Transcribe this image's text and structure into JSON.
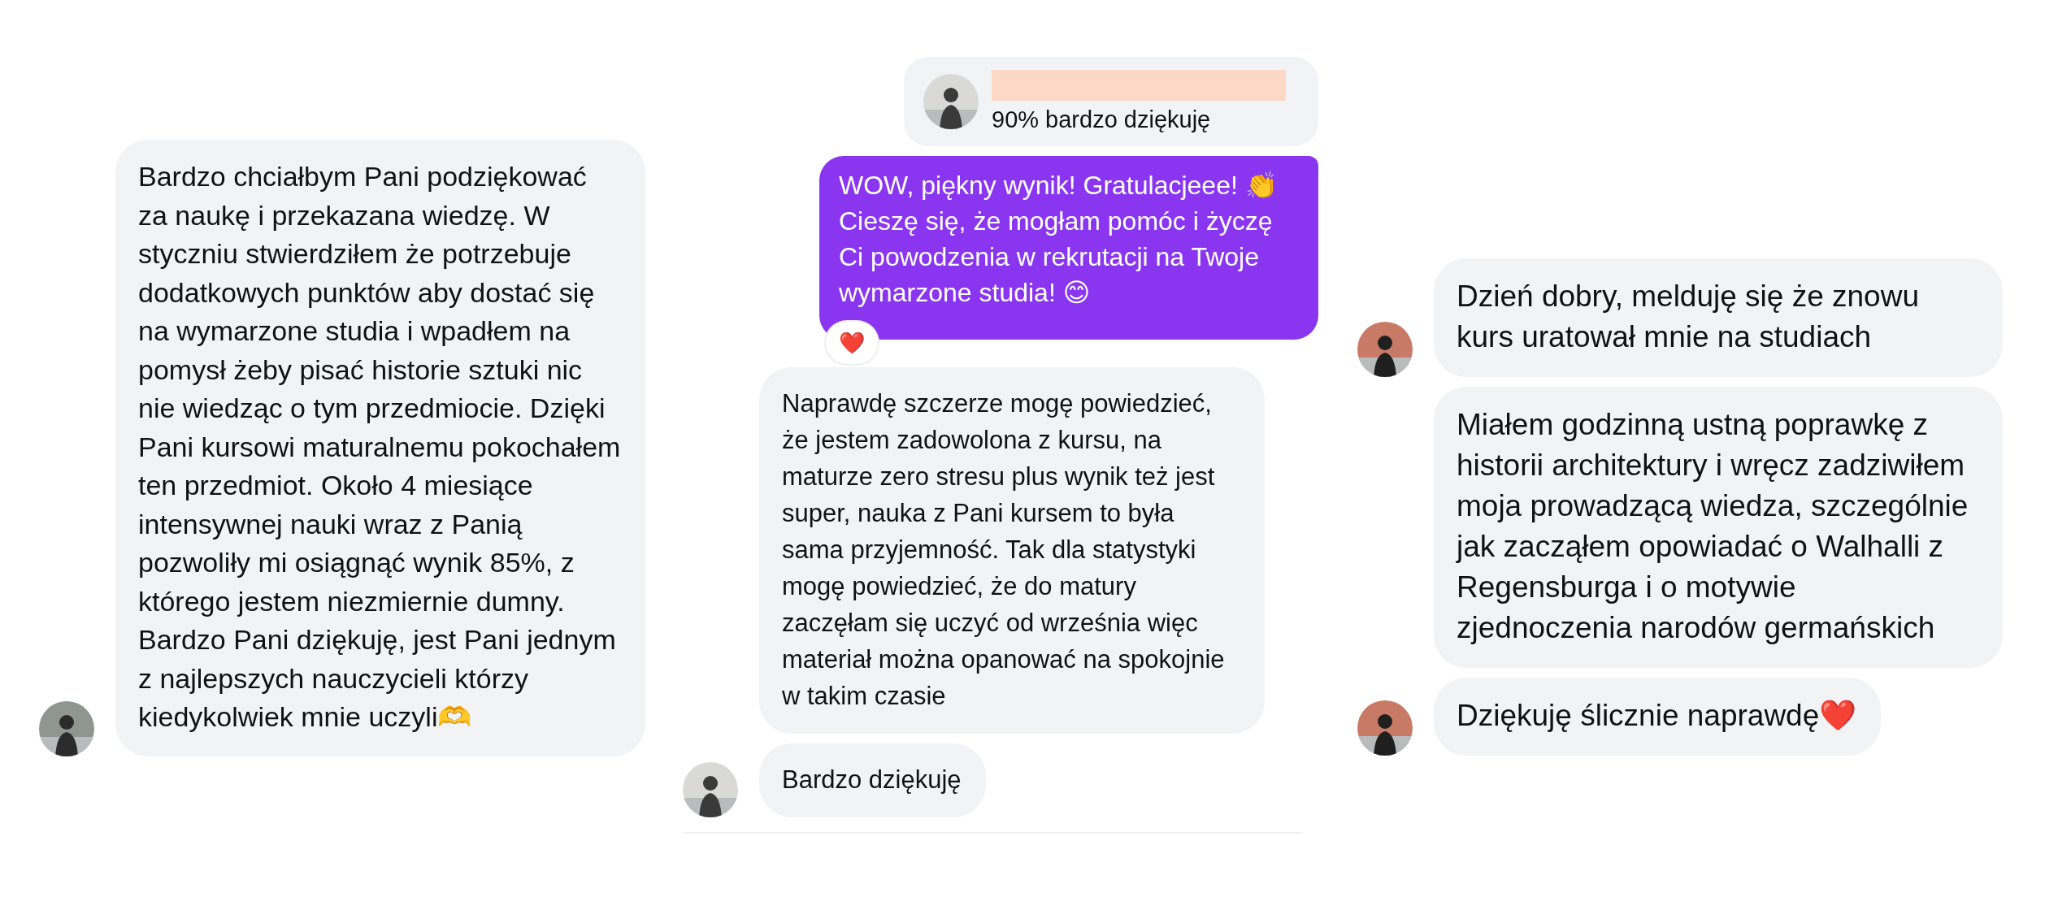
{
  "conversations": [
    {
      "messages": [
        {
          "kind": "incoming",
          "avatar": true,
          "text": "Bardzo chciałbym Pani podziękować za naukę i przekazana wiedzę. W styczniu stwierdziłem że potrzebuje dodatkowych punktów aby dostać się na wymarzone studia i wpadłem na pomysł żeby pisać historie sztuki nic nie wiedząc o tym przedmiocie. Dzięki Pani kursowi maturalnemu pokochałem ten przedmiot. Około 4 miesiące intensywnej nauki wraz z Panią pozwoliły mi osiągnąć wynik 85%, z którego jestem niezmiernie dumny. Bardzo Pani dziękuję, jest Pani jednym z najlepszych nauczycieli którzy kiedykolwiek mnie uczyli🫶"
        }
      ]
    },
    {
      "messages": [
        {
          "kind": "quote",
          "avatar": true,
          "text": "90% bardzo dziękuję"
        },
        {
          "kind": "outgoing",
          "text": "WOW, piękny wynik! Gratulacjeee! 👏 Cieszę się, że mogłam pomóc i życzę Ci powodzenia w rekrutacji na Twoje wymarzone studia! 😊",
          "reaction": "❤️"
        },
        {
          "kind": "incoming",
          "avatar": false,
          "text": "Naprawdę szczerze mogę powiedzieć, że jestem zadowolona z kursu, na maturze zero stresu plus wynik też jest super, nauka z Pani kursem to była sama przyjemność. Tak dla statystyki mogę powiedzieć, że do matury zaczęłam się uczyć od września więc materiał można opanować na spokojnie w takim czasie"
        },
        {
          "kind": "incoming",
          "avatar": true,
          "text": "Bardzo dziękuję"
        }
      ]
    },
    {
      "messages": [
        {
          "kind": "incoming",
          "avatar": true,
          "text": "Dzień dobry, melduję się że znowu kurs uratował mnie na studiach"
        },
        {
          "kind": "incoming",
          "avatar": false,
          "text": "Miałem godzinną ustną poprawkę z historii architektury i wręcz zadziwiłem moja prowadzącą wiedza, szczególnie jak zacząłem opowiadać o Walhalli z Regensburga i o motywie zjednoczenia narodów germańskich"
        },
        {
          "kind": "incoming",
          "avatar": true,
          "text": "Dziękuję ślicznie naprawdę❤️"
        }
      ]
    }
  ]
}
